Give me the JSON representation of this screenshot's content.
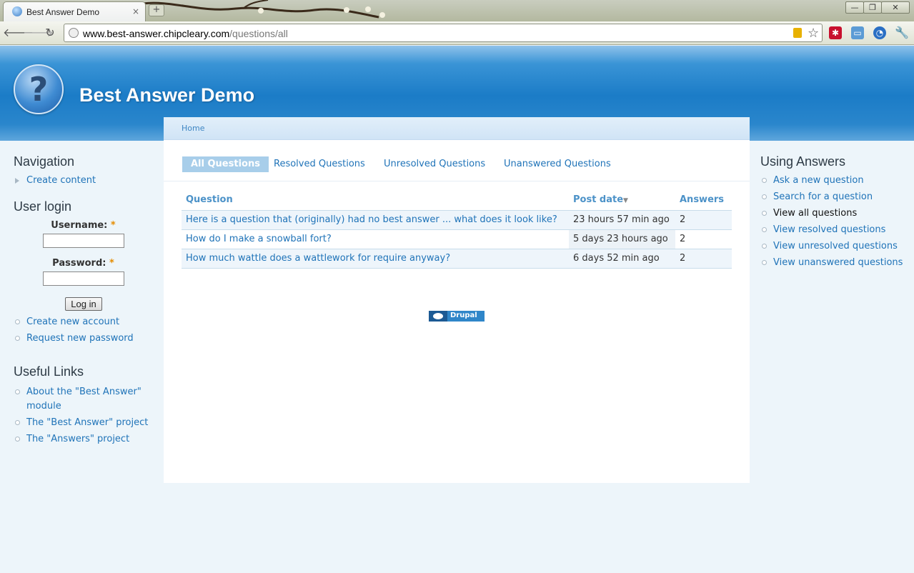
{
  "browser": {
    "tab_title": "Best Answer Demo",
    "tab_close": "×",
    "new_tab": "+",
    "url_host": "www.best-answer.chipcleary.com",
    "url_path": "/questions/all",
    "win_min": "—",
    "win_max": "❐",
    "win_close": "✕"
  },
  "site": {
    "name": "Best Answer Demo",
    "logo_glyph": "?"
  },
  "breadcrumb": "Home",
  "tabs": [
    {
      "label": "All Questions"
    },
    {
      "label": "Resolved Questions"
    },
    {
      "label": "Unresolved Questions"
    },
    {
      "label": "Unanswered Questions"
    }
  ],
  "table": {
    "headers": {
      "question": "Question",
      "post_date": "Post date",
      "answers": "Answers"
    },
    "rows": [
      {
        "question": "Here is a question that (originally) had no best answer ... what does it look like?",
        "date": "23 hours 57 min ago",
        "answers": "2"
      },
      {
        "question": "How do I make a snowball fort?",
        "date": "5 days 23 hours ago",
        "answers": "2"
      },
      {
        "question": "How much wattle does a wattlework for require anyway?",
        "date": "6 days 52 min ago",
        "answers": "2"
      }
    ]
  },
  "drupal_badge": "Drupal",
  "navigation": {
    "title": "Navigation",
    "items": [
      {
        "label": "Create content"
      }
    ]
  },
  "login": {
    "title": "User login",
    "username_label": "Username:",
    "password_label": "Password:",
    "required_mark": "*",
    "button": "Log in",
    "links": [
      {
        "label": "Create new account"
      },
      {
        "label": "Request new password"
      }
    ]
  },
  "useful_links": {
    "title": "Useful Links",
    "items": [
      {
        "label": "About the \"Best Answer\" module"
      },
      {
        "label": "The \"Best Answer\" project"
      },
      {
        "label": "The \"Answers\" project"
      }
    ]
  },
  "using_answers": {
    "title": "Using Answers",
    "items": [
      {
        "label": "Ask a new question"
      },
      {
        "label": "Search for a question"
      },
      {
        "label": "View all questions"
      },
      {
        "label": "View resolved questions"
      },
      {
        "label": "View unresolved questions"
      },
      {
        "label": "View unanswered questions"
      }
    ]
  },
  "colors": {
    "header_blue": "#1b7cc7",
    "link": "#1f73b8",
    "page_bg": "#edf5fa"
  }
}
